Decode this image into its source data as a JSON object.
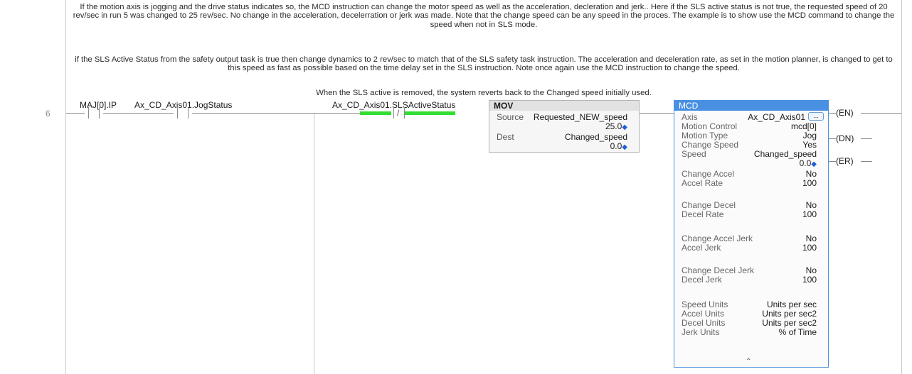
{
  "rung": {
    "number": "6"
  },
  "comments": {
    "c1": "If the motion axis is jogging and the drive status indicates so, the MCD instruction can change the motor speed as well as the acceleration, decleration and jerk..  Here if the SLS active status is not true,  the requested speed of 20 rev/sec in run 5 was changed to 25 rev/sec.   No change in the acceleration, decelerration or jerk was made.   Note that the change speed can be any speed in the proces.  The example is to show use the MCD command to change the speed when not in SLS mode.",
    "c2": "if the SLS Active Status from the safety output task is true then change dynamics to 2 rev/sec to match that of the SLS safety task instruction.   The acceleration and deceleration rate, as set in the motion planner, is changed to get to this speed as fast as possible based on the time delay set in the SLS instruction.   Note once again use the MCD instruction to change the speed.",
    "c3": "When the SLS active is removed, the system reverts back to the Changed speed initially used."
  },
  "contacts": [
    {
      "tag": "MAJ[0].IP",
      "type": "XIC"
    },
    {
      "tag": "Ax_CD_Axis01.JogStatus",
      "type": "XIC"
    },
    {
      "tag": "Ax_CD_Axis01.SLSActiveStatus",
      "type": "XIO",
      "energized": true
    }
  ],
  "mov": {
    "title": "MOV",
    "source_label": "Source",
    "source_tag": "Requested_NEW_speed",
    "source_value": "25.0",
    "dest_label": "Dest",
    "dest_tag": "Changed_speed",
    "dest_value": "0.0"
  },
  "mcd": {
    "title": "MCD",
    "axis_label": "Axis",
    "axis_value": "Ax_CD_Axis01",
    "ellipsis": "...",
    "motion_control_label": "Motion Control",
    "motion_control_value": "mcd[0]",
    "motion_type_label": "Motion Type",
    "motion_type_value": "Jog",
    "change_speed_label": "Change Speed",
    "change_speed_value": "Yes",
    "speed_label": "Speed",
    "speed_value": "Changed_speed",
    "speed_live": "0.0",
    "change_accel_label": "Change Accel",
    "change_accel_value": "No",
    "accel_rate_label": "Accel Rate",
    "accel_rate_value": "100",
    "change_decel_label": "Change Decel",
    "change_decel_value": "No",
    "decel_rate_label": "Decel Rate",
    "decel_rate_value": "100",
    "change_accel_jerk_label": "Change Accel Jerk",
    "change_accel_jerk_value": "No",
    "accel_jerk_label": "Accel Jerk",
    "accel_jerk_value": "100",
    "change_decel_jerk_label": "Change Decel Jerk",
    "change_decel_jerk_value": "No",
    "decel_jerk_label": "Decel Jerk",
    "decel_jerk_value": "100",
    "speed_units_label": "Speed Units",
    "speed_units_value": "Units per sec",
    "accel_units_label": "Accel Units",
    "accel_units_value": "Units per sec2",
    "decel_units_label": "Decel Units",
    "decel_units_value": "Units per sec2",
    "jerk_units_label": "Jerk Units",
    "jerk_units_value": "% of Time",
    "collapse_icon": "double-chevron-up-icon"
  },
  "outputs": {
    "en": "EN",
    "dn": "DN",
    "er": "ER"
  },
  "colors": {
    "energized": "#33dd33",
    "mcd_header": "#4a90e2",
    "arrow": "#1f5fd6"
  }
}
